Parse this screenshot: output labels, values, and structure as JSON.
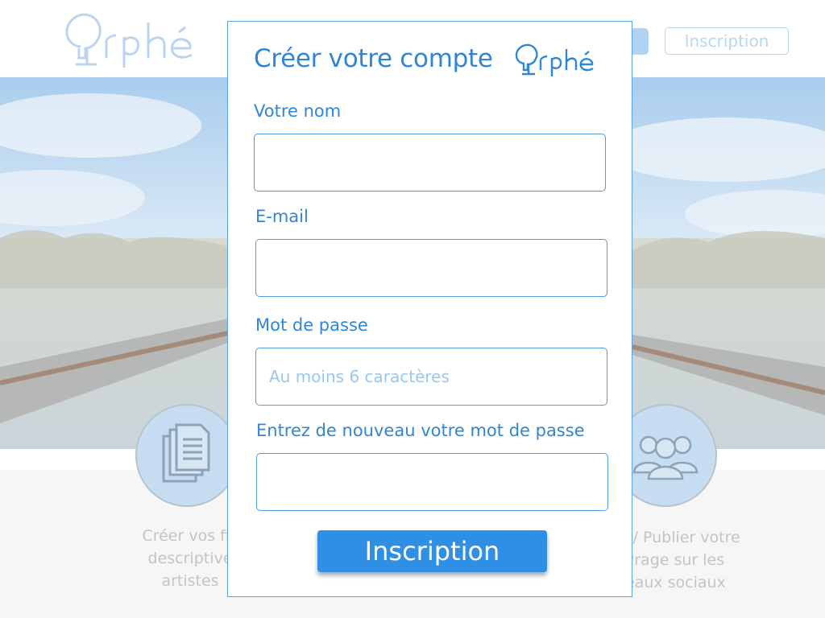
{
  "background": {
    "header": {
      "logo_text": "Orphée",
      "signup_label": "Inscription"
    },
    "features": [
      {
        "icon": "document-icon",
        "lines": [
          "Créer vos fic",
          "descriptive",
          "artistes"
        ]
      },
      {
        "icon": "users-icon",
        "lines": [
          "er / Publier votre",
          "vrage sur les",
          "eaux sociaux"
        ]
      }
    ]
  },
  "modal": {
    "title": "Créer votre compte",
    "logo_text": "Orphée",
    "fields": [
      {
        "label": "Votre nom",
        "value": "",
        "placeholder": ""
      },
      {
        "label": "E-mail",
        "value": "",
        "placeholder": ""
      },
      {
        "label": "Mot de passe",
        "value": "",
        "placeholder": "Au moins 6 caractères"
      },
      {
        "label": "Entrez de nouveau votre mot de passe",
        "value": "",
        "placeholder": ""
      }
    ],
    "submit_label": "Inscription"
  },
  "colors": {
    "accent": "#2f86d6",
    "button": "#2f8fe4",
    "field_border": "#4d9be0"
  }
}
